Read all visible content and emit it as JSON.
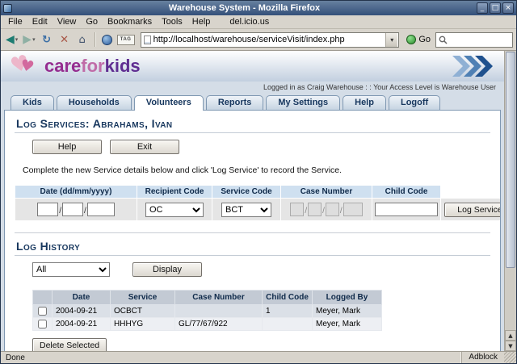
{
  "window": {
    "title": "Warehouse System - Mozilla Firefox"
  },
  "icons": {
    "minimize": "_",
    "maximize": "□",
    "close": "×",
    "back": "◀",
    "forward": "▶",
    "reload": "↻",
    "stop": "✕",
    "home": "⌂",
    "caret_down": "▾",
    "scroll_up": "▲",
    "scroll_down": "▼",
    "heart": "♥"
  },
  "menubar": {
    "items": [
      "File",
      "Edit",
      "View",
      "Go",
      "Bookmarks",
      "Tools",
      "Help"
    ],
    "extra": "del.icio.us"
  },
  "toolbar": {
    "url": "http://localhost/warehouse/serviceVisit/index.php",
    "go_label": "Go",
    "tag_label": "TAG"
  },
  "header": {
    "logo_care": "care",
    "logo_for": "for",
    "logo_kids": "kids",
    "login_info": "Logged in as Craig Warehouse  : :  Your Access Level is Warehouse User"
  },
  "tabs": [
    {
      "label": "Kids"
    },
    {
      "label": "Households"
    },
    {
      "label": "Volunteers"
    },
    {
      "label": "Reports"
    },
    {
      "label": "My Settings"
    },
    {
      "label": "Help"
    },
    {
      "label": "Logoff"
    }
  ],
  "service_form": {
    "title": "Log Services: Abrahams, Ivan",
    "help_button": "Help",
    "exit_button": "Exit",
    "instructions": "Complete the new Service details below and click 'Log Service' to record the Service.",
    "headers": [
      "Date (dd/mm/yyyy)",
      "Recipient Code",
      "Service Code",
      "Case Number",
      "Child Code"
    ],
    "recipient_selected": "OC",
    "service_selected": "BCT",
    "log_service_button": "Log Service"
  },
  "log_history": {
    "title": "Log History",
    "filter_selected": "All",
    "display_button": "Display",
    "columns": [
      "Date",
      "Service",
      "Case Number",
      "Child Code",
      "Logged By"
    ],
    "rows": [
      {
        "date": "2004-09-21",
        "service": "OCBCT",
        "case_number": "",
        "child_code": "1",
        "logged_by": "Meyer, Mark"
      },
      {
        "date": "2004-09-21",
        "service": "HHHYG",
        "case_number": "GL/77/67/922",
        "child_code": "",
        "logged_by": "Meyer, Mark"
      }
    ],
    "delete_button": "Delete Selected"
  },
  "statusbar": {
    "status": "Done",
    "adblock": "Adblock"
  },
  "colors": {
    "titlebar": "#34507a",
    "chrome_bg": "#d8d4cc",
    "page_bg": "#d4dde7",
    "accent_navy": "#17375e",
    "tab_border": "#7f98b2",
    "form_header_bg": "#cfe0f0",
    "form_row_bg": "#e5e5e5",
    "table_header_bg": "#c3cad4",
    "row_odd_bg": "#dbe0e7",
    "row_even_bg": "#edeff3",
    "logo_care": "#952d90",
    "logo_for": "#c06ca8",
    "logo_kids": "#5f2d91"
  }
}
